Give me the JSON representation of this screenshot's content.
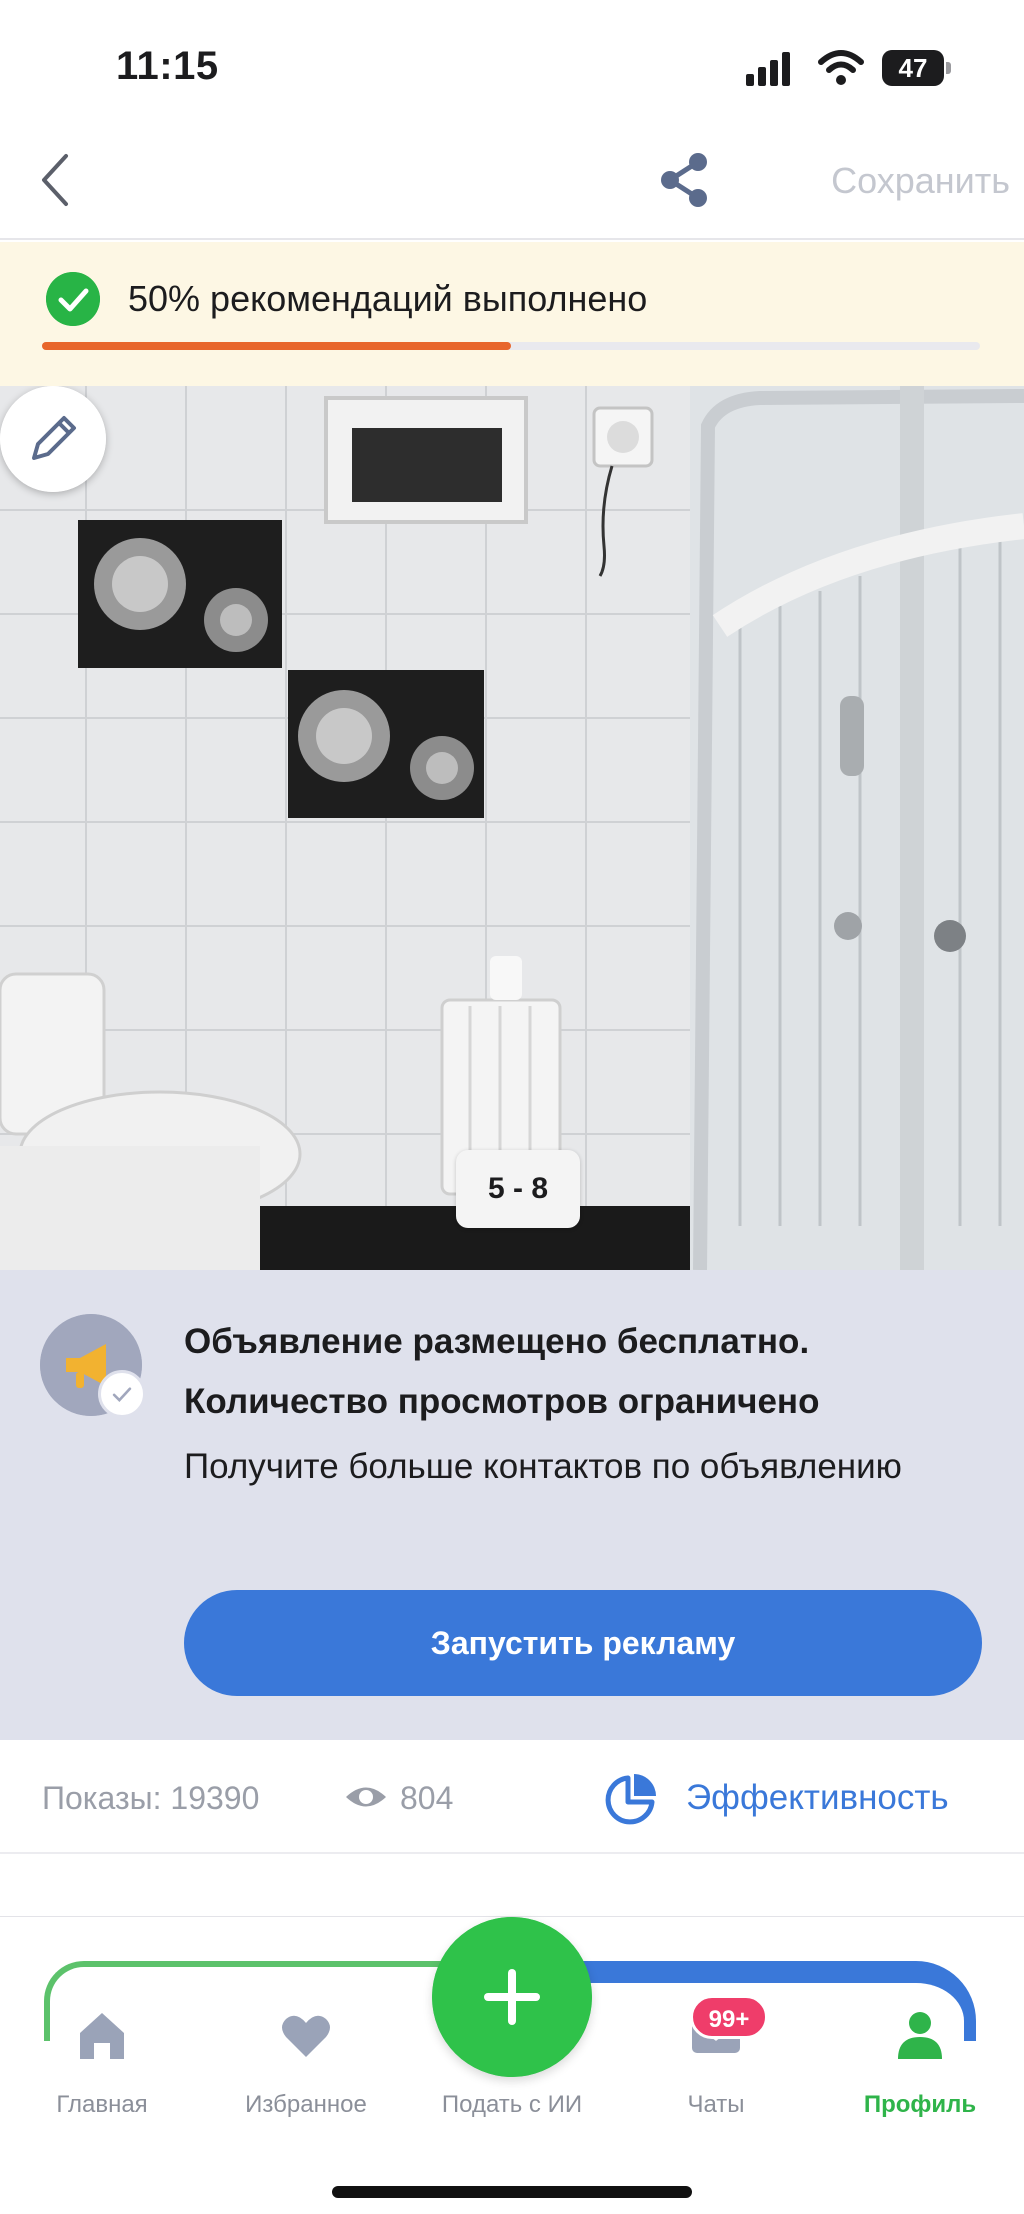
{
  "status_bar": {
    "time": "11:15",
    "battery": "47"
  },
  "header": {
    "back_icon": "chevron-left-icon",
    "share_icon": "share-icon",
    "save_label": "Сохранить"
  },
  "progress": {
    "text": "50% рекомендаций выполнено",
    "fraction": 0.5,
    "fill_color": "#e8662b",
    "check_color": "#28b446"
  },
  "photo": {
    "counter": "5 - 8",
    "edit_icon": "pencil-icon"
  },
  "promo": {
    "title": "Объявление размещено бесплатно. Количество просмотров ограничено",
    "subtitle": "Получите больше контактов по объявлению",
    "button_label": "Запустить рекламу",
    "icon": "megaphone-icon"
  },
  "stats": {
    "impressions": "Показы: 19390",
    "views": "804",
    "efficiency_label": "Эффективность"
  },
  "tabs": [
    {
      "label": "Главная",
      "icon": "home-icon"
    },
    {
      "label": "Избранное",
      "icon": "heart-icon"
    },
    {
      "label": "Подать с ИИ",
      "icon": "plus-icon"
    },
    {
      "label": "Чаты",
      "icon": "mail-icon",
      "badge": "99+"
    },
    {
      "label": "Профиль",
      "icon": "profile-icon",
      "active": true
    }
  ],
  "colors": {
    "accent_blue": "#3a78d9",
    "accent_green": "#2fc24a",
    "badge_red": "#ef3d6a"
  }
}
